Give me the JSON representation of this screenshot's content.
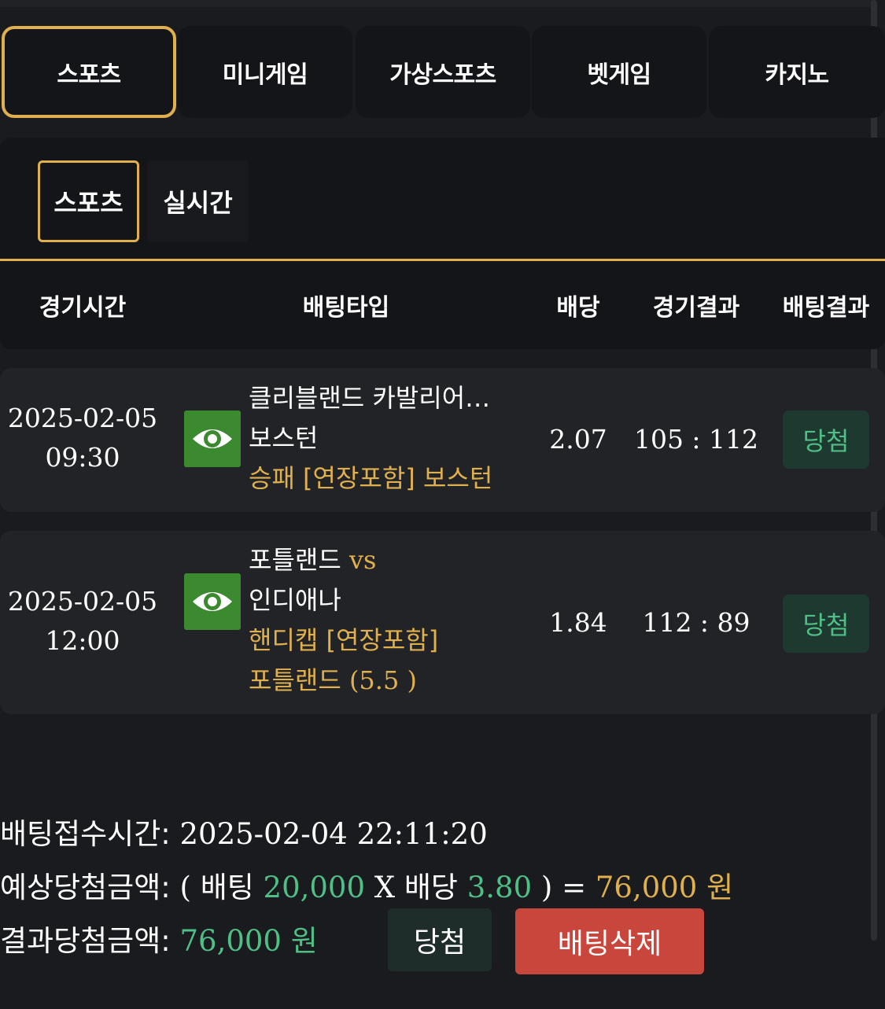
{
  "main_tabs": [
    {
      "label": "스포츠",
      "active": true
    },
    {
      "label": "미니게임",
      "active": false
    },
    {
      "label": "가상스포츠",
      "active": false
    },
    {
      "label": "벳게임",
      "active": false
    },
    {
      "label": "카지노",
      "active": false
    }
  ],
  "sub_tabs": [
    {
      "label": "스포츠",
      "active": true
    },
    {
      "label": "실시간",
      "active": false
    }
  ],
  "columns": {
    "time": "경기시간",
    "bet_type": "배팅타입",
    "odds": "배당",
    "game_result": "경기결과",
    "bet_result": "배팅결과"
  },
  "bets": [
    {
      "date": "2025-02-05",
      "time": "09:30",
      "match_line1": "클리블랜드 카발리어…",
      "match_line2": "보스턴",
      "pick": "승패 [연장포함] 보스턴",
      "odds": "2.07",
      "score": "105 : 112",
      "result": "당첨"
    },
    {
      "date": "2025-02-05",
      "time": "12:00",
      "home": "포틀랜드",
      "vs": "vs",
      "away": "인디애나",
      "pick_line1": "핸디캡 [연장포함]",
      "pick_line2_team": "포틀랜드",
      "pick_line2_value": "(5.5 )",
      "odds": "1.84",
      "score": "112 : 89",
      "result": "당첨"
    }
  ],
  "summary": {
    "bet_time_label": "배팅접수시간:",
    "bet_time": "2025-02-04 22:11:20",
    "expected_label": "예상당첨금액:",
    "open_paren": "(",
    "stake_label": "배팅",
    "stake": "20,000",
    "times": "X",
    "odds_label": "배당",
    "total_odds": "3.80",
    "close_paren_eq": ") =",
    "expected_amount": "76,000 원",
    "result_label": "결과당첨금액:",
    "result_amount": "76,000 원",
    "status_button": "당첨",
    "delete_button": "배팅삭제"
  },
  "icons": {
    "view": "eye-icon"
  },
  "colors": {
    "accent_gold": "#e0b04f",
    "win_green": "#4fbf86",
    "eye_button": "#3b8a2f",
    "delete_red": "#c9463d"
  }
}
